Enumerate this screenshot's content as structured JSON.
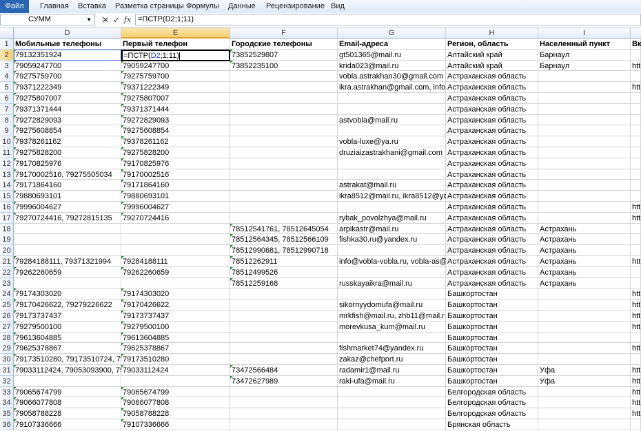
{
  "ribbon": {
    "tabs": [
      "Файл",
      "Главная",
      "Вставка",
      "Разметка страницы",
      "Формулы",
      "Данные",
      "Рецензирование",
      "Вид"
    ]
  },
  "formula_bar": {
    "name_box": "СУММ",
    "cancel": "✕",
    "enter": "✓",
    "fx": "fx",
    "formula": "=ПСТР(D2;1;11)"
  },
  "active_cell_edit": {
    "prefix": "=ПСТР(",
    "ref": "D2",
    "suffix": ";1;11)"
  },
  "columns": [
    "D",
    "E",
    "F",
    "G",
    "H",
    "I"
  ],
  "header_row": [
    "Мобильные телефоны",
    "Первый телефон",
    "Городские телефоны",
    "Email-адреса",
    "Регион, область",
    "Населенный пункт",
    "Вк"
  ],
  "rows": [
    {
      "n": "2",
      "d": "79132351924",
      "e": "",
      "f": "73852529807",
      "g": "gt501365@mail.ru",
      "h": "Алтайский край",
      "i": "Барнаул",
      "j": ""
    },
    {
      "n": "3",
      "d": "79059247700",
      "e": "79059247700",
      "f": "73852235100",
      "g": "krida023@mail.ru",
      "h": "Алтайский край",
      "i": "Барнаул",
      "j": "htt"
    },
    {
      "n": "4",
      "d": "79275759700",
      "e": "79275759700",
      "f": "",
      "g": "vobla.astrakhan30@gmail.com",
      "h": "Астраханская область",
      "i": "",
      "j": ""
    },
    {
      "n": "5",
      "d": "79371222349",
      "e": "79371222349",
      "f": "",
      "g": "ikra.astrakhan@gmail.com, info",
      "h": "Астраханская область",
      "i": "",
      "j": "htt"
    },
    {
      "n": "6",
      "d": "79275807007",
      "e": "79275807007",
      "f": "",
      "g": "",
      "h": "Астраханская область",
      "i": "",
      "j": ""
    },
    {
      "n": "7",
      "d": "79371371444",
      "e": "79371371444",
      "f": "",
      "g": "",
      "h": "Астраханская область",
      "i": "",
      "j": ""
    },
    {
      "n": "8",
      "d": "79272829093",
      "e": "79272829093",
      "f": "",
      "g": "astvobla@mail.ru",
      "h": "Астраханская область",
      "i": "",
      "j": ""
    },
    {
      "n": "9",
      "d": "79275608854",
      "e": "79275608854",
      "f": "",
      "g": "",
      "h": "Астраханская область",
      "i": "",
      "j": ""
    },
    {
      "n": "10",
      "d": "79378261162",
      "e": "79378261162",
      "f": "",
      "g": "vobla-luxe@ya.ru",
      "h": "Астраханская область",
      "i": "",
      "j": ""
    },
    {
      "n": "11",
      "d": "79275828200",
      "e": "79275828200",
      "f": "",
      "g": "druziaizastrakhani@gmail.com",
      "h": "Астраханская область",
      "i": "",
      "j": ""
    },
    {
      "n": "12",
      "d": "79170825976",
      "e": "79170825976",
      "f": "",
      "g": "",
      "h": "Астраханская область",
      "i": "",
      "j": ""
    },
    {
      "n": "13",
      "d": "79170002516, 79275505034",
      "e": "79170002516",
      "f": "",
      "g": "",
      "h": "Астраханская область",
      "i": "",
      "j": ""
    },
    {
      "n": "14",
      "d": "79171864160",
      "e": "79171864160",
      "f": "",
      "g": "astrakat@mail.ru",
      "h": "Астраханская область",
      "i": "",
      "j": ""
    },
    {
      "n": "15",
      "d": "79880693101",
      "e": "79880693101",
      "f": "",
      "g": "ikra8512@mail.ru, ikra8512@ya",
      "h": "Астраханская область",
      "i": "",
      "j": ""
    },
    {
      "n": "16",
      "d": "79996004627",
      "e": "79996004627",
      "f": "",
      "g": "",
      "h": "Астраханская область",
      "i": "",
      "j": "htt"
    },
    {
      "n": "17",
      "d": "79270724416, 79272815135",
      "e": "79270724416",
      "f": "",
      "g": "rybak_povolzhya@mail.ru",
      "h": "Астраханская область",
      "i": "",
      "j": "htt"
    },
    {
      "n": "18",
      "d": "",
      "e": "",
      "f": "78512541761, 78512645054",
      "g": "arpikastr@mail.ru",
      "h": "Астраханская область",
      "i": "Астрахань",
      "j": ""
    },
    {
      "n": "19",
      "d": "",
      "e": "",
      "f": "78512564345, 78512566109",
      "g": "fishka30.ru@yandex.ru",
      "h": "Астраханская область",
      "i": "Астрахань",
      "j": ""
    },
    {
      "n": "20",
      "d": "",
      "e": "",
      "f": "78512990681, 78512990718",
      "g": "",
      "h": "Астраханская область",
      "i": "Астрахань",
      "j": ""
    },
    {
      "n": "21",
      "d": "79284188111, 79371321994",
      "e": "79284188111",
      "f": "78512262911",
      "g": "info@vobla-vobla.ru, vobla-as@",
      "h": "Астраханская область",
      "i": "Астрахань",
      "j": "htt"
    },
    {
      "n": "22",
      "d": "79262260659",
      "e": "79262260659",
      "f": "78512499526",
      "g": "",
      "h": "Астраханская область",
      "i": "Астрахань",
      "j": ""
    },
    {
      "n": "23",
      "d": "",
      "e": "",
      "f": "78512259168",
      "g": "russkayaikra@mail.ru",
      "h": "Астраханская область",
      "i": "Астрахань",
      "j": ""
    },
    {
      "n": "24",
      "d": "79174303020",
      "e": "79174303020",
      "f": "",
      "g": "",
      "h": "Башкортостан",
      "i": "",
      "j": "htt"
    },
    {
      "n": "25",
      "d": "79170426622, 79279226622",
      "e": "79170426622",
      "f": "",
      "g": "sikornyydomufa@mail.ru",
      "h": "Башкортостан",
      "i": "",
      "j": "htt"
    },
    {
      "n": "26",
      "d": "79173737437",
      "e": "79173737437",
      "f": "",
      "g": "mrkfish@mail.ru, zhb11@mail.r",
      "h": "Башкортостан",
      "i": "",
      "j": "htt"
    },
    {
      "n": "27",
      "d": "79279500100",
      "e": "79279500100",
      "f": "",
      "g": "morevkusa_kum@mail.ru",
      "h": "Башкортостан",
      "i": "",
      "j": "htt"
    },
    {
      "n": "28",
      "d": "79613604885",
      "e": "79613604885",
      "f": "",
      "g": "",
      "h": "Башкортостан",
      "i": "",
      "j": ""
    },
    {
      "n": "29",
      "d": "79625378867",
      "e": "79625378867",
      "f": "",
      "g": "fishmarket74@yandex.ru",
      "h": "Башкортостан",
      "i": "",
      "j": "htt"
    },
    {
      "n": "30",
      "d": "79173510280, 79173510724, 7917",
      "e": "79173510280",
      "f": "",
      "g": "zakaz@chefport.ru",
      "h": "Башкортостан",
      "i": "",
      "j": ""
    },
    {
      "n": "31",
      "d": "79033112424, 79053093900, 7987",
      "e": "79033112424",
      "f": "73472566484",
      "g": "radamir1@mail.ru",
      "h": "Башкортостан",
      "i": "Уфа",
      "j": "htt"
    },
    {
      "n": "32",
      "d": "",
      "e": "",
      "f": "73472627989",
      "g": "raki-ufa@mail.ru",
      "h": "Башкортостан",
      "i": "Уфа",
      "j": "htt"
    },
    {
      "n": "33",
      "d": "79065674799",
      "e": "79065674799",
      "f": "",
      "g": "",
      "h": "Белгородская область",
      "i": "",
      "j": "htt"
    },
    {
      "n": "34",
      "d": "79066077808",
      "e": "79066077808",
      "f": "",
      "g": "",
      "h": "Белгородская область",
      "i": "",
      "j": "htt"
    },
    {
      "n": "35",
      "d": "79058788228",
      "e": "79058788228",
      "f": "",
      "g": "",
      "h": "Белгородская область",
      "i": "",
      "j": "htt"
    },
    {
      "n": "36",
      "d": "79107336666",
      "e": "79107336666",
      "f": "",
      "g": "",
      "h": "Брянская область",
      "i": "",
      "j": ""
    }
  ]
}
